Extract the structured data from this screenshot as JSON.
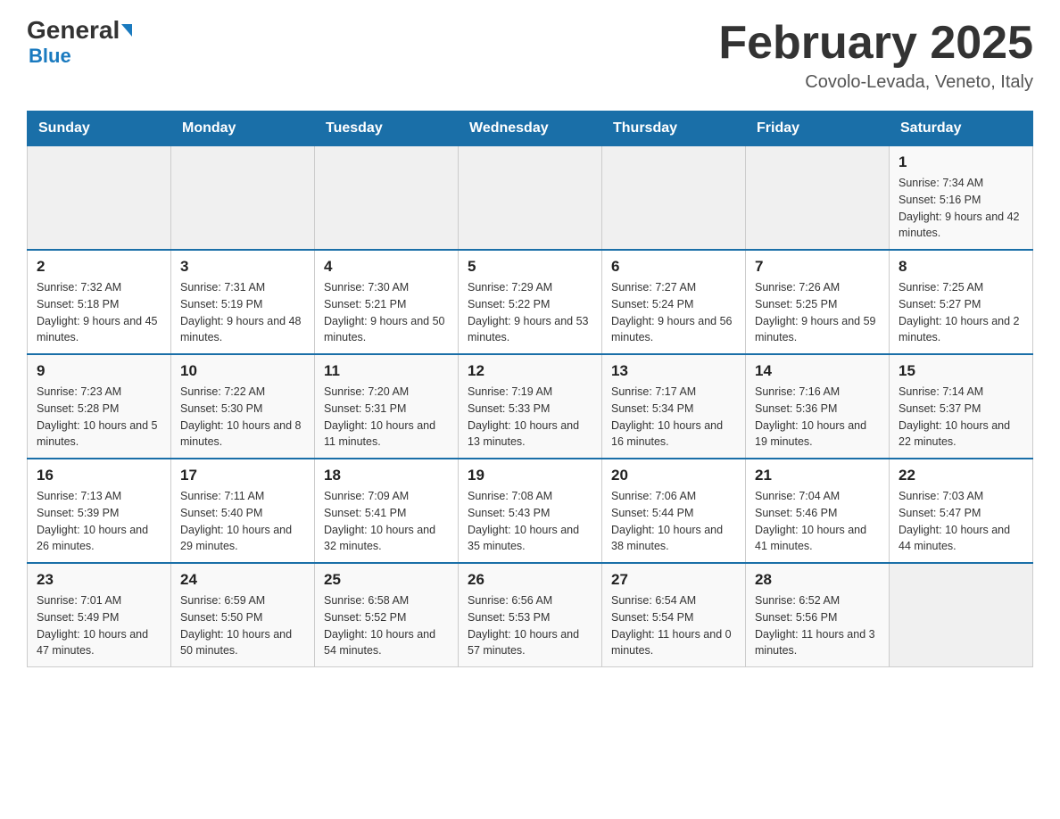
{
  "header": {
    "logo_general": "General",
    "logo_blue": "Blue",
    "month_title": "February 2025",
    "location": "Covolo-Levada, Veneto, Italy"
  },
  "days_of_week": [
    "Sunday",
    "Monday",
    "Tuesday",
    "Wednesday",
    "Thursday",
    "Friday",
    "Saturday"
  ],
  "weeks": [
    {
      "days": [
        {
          "num": "",
          "info": ""
        },
        {
          "num": "",
          "info": ""
        },
        {
          "num": "",
          "info": ""
        },
        {
          "num": "",
          "info": ""
        },
        {
          "num": "",
          "info": ""
        },
        {
          "num": "",
          "info": ""
        },
        {
          "num": "1",
          "info": "Sunrise: 7:34 AM\nSunset: 5:16 PM\nDaylight: 9 hours and 42 minutes."
        }
      ]
    },
    {
      "days": [
        {
          "num": "2",
          "info": "Sunrise: 7:32 AM\nSunset: 5:18 PM\nDaylight: 9 hours and 45 minutes."
        },
        {
          "num": "3",
          "info": "Sunrise: 7:31 AM\nSunset: 5:19 PM\nDaylight: 9 hours and 48 minutes."
        },
        {
          "num": "4",
          "info": "Sunrise: 7:30 AM\nSunset: 5:21 PM\nDaylight: 9 hours and 50 minutes."
        },
        {
          "num": "5",
          "info": "Sunrise: 7:29 AM\nSunset: 5:22 PM\nDaylight: 9 hours and 53 minutes."
        },
        {
          "num": "6",
          "info": "Sunrise: 7:27 AM\nSunset: 5:24 PM\nDaylight: 9 hours and 56 minutes."
        },
        {
          "num": "7",
          "info": "Sunrise: 7:26 AM\nSunset: 5:25 PM\nDaylight: 9 hours and 59 minutes."
        },
        {
          "num": "8",
          "info": "Sunrise: 7:25 AM\nSunset: 5:27 PM\nDaylight: 10 hours and 2 minutes."
        }
      ]
    },
    {
      "days": [
        {
          "num": "9",
          "info": "Sunrise: 7:23 AM\nSunset: 5:28 PM\nDaylight: 10 hours and 5 minutes."
        },
        {
          "num": "10",
          "info": "Sunrise: 7:22 AM\nSunset: 5:30 PM\nDaylight: 10 hours and 8 minutes."
        },
        {
          "num": "11",
          "info": "Sunrise: 7:20 AM\nSunset: 5:31 PM\nDaylight: 10 hours and 11 minutes."
        },
        {
          "num": "12",
          "info": "Sunrise: 7:19 AM\nSunset: 5:33 PM\nDaylight: 10 hours and 13 minutes."
        },
        {
          "num": "13",
          "info": "Sunrise: 7:17 AM\nSunset: 5:34 PM\nDaylight: 10 hours and 16 minutes."
        },
        {
          "num": "14",
          "info": "Sunrise: 7:16 AM\nSunset: 5:36 PM\nDaylight: 10 hours and 19 minutes."
        },
        {
          "num": "15",
          "info": "Sunrise: 7:14 AM\nSunset: 5:37 PM\nDaylight: 10 hours and 22 minutes."
        }
      ]
    },
    {
      "days": [
        {
          "num": "16",
          "info": "Sunrise: 7:13 AM\nSunset: 5:39 PM\nDaylight: 10 hours and 26 minutes."
        },
        {
          "num": "17",
          "info": "Sunrise: 7:11 AM\nSunset: 5:40 PM\nDaylight: 10 hours and 29 minutes."
        },
        {
          "num": "18",
          "info": "Sunrise: 7:09 AM\nSunset: 5:41 PM\nDaylight: 10 hours and 32 minutes."
        },
        {
          "num": "19",
          "info": "Sunrise: 7:08 AM\nSunset: 5:43 PM\nDaylight: 10 hours and 35 minutes."
        },
        {
          "num": "20",
          "info": "Sunrise: 7:06 AM\nSunset: 5:44 PM\nDaylight: 10 hours and 38 minutes."
        },
        {
          "num": "21",
          "info": "Sunrise: 7:04 AM\nSunset: 5:46 PM\nDaylight: 10 hours and 41 minutes."
        },
        {
          "num": "22",
          "info": "Sunrise: 7:03 AM\nSunset: 5:47 PM\nDaylight: 10 hours and 44 minutes."
        }
      ]
    },
    {
      "days": [
        {
          "num": "23",
          "info": "Sunrise: 7:01 AM\nSunset: 5:49 PM\nDaylight: 10 hours and 47 minutes."
        },
        {
          "num": "24",
          "info": "Sunrise: 6:59 AM\nSunset: 5:50 PM\nDaylight: 10 hours and 50 minutes."
        },
        {
          "num": "25",
          "info": "Sunrise: 6:58 AM\nSunset: 5:52 PM\nDaylight: 10 hours and 54 minutes."
        },
        {
          "num": "26",
          "info": "Sunrise: 6:56 AM\nSunset: 5:53 PM\nDaylight: 10 hours and 57 minutes."
        },
        {
          "num": "27",
          "info": "Sunrise: 6:54 AM\nSunset: 5:54 PM\nDaylight: 11 hours and 0 minutes."
        },
        {
          "num": "28",
          "info": "Sunrise: 6:52 AM\nSunset: 5:56 PM\nDaylight: 11 hours and 3 minutes."
        },
        {
          "num": "",
          "info": ""
        }
      ]
    }
  ]
}
